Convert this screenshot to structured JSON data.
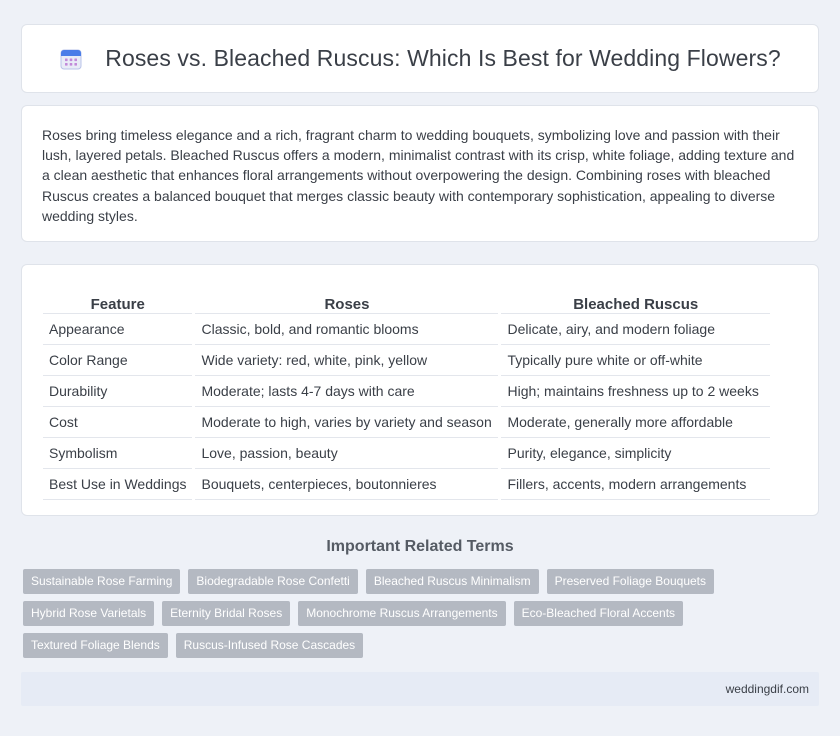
{
  "header": {
    "title": "Roses vs. Bleached Ruscus: Which Is Best for Wedding Flowers?",
    "icon": "calendar-icon"
  },
  "intro": {
    "text": "Roses bring timeless elegance and a rich, fragrant charm to wedding bouquets, symbolizing love and passion with their lush, layered petals. Bleached Ruscus offers a modern, minimalist contrast with its crisp, white foliage, adding texture and a clean aesthetic that enhances floral arrangements without overpowering the design. Combining roses with bleached Ruscus creates a balanced bouquet that merges classic beauty with contemporary sophistication, appealing to diverse wedding styles."
  },
  "table": {
    "headers": [
      "Feature",
      "Roses",
      "Bleached Ruscus"
    ],
    "rows": [
      [
        "Appearance",
        "Classic, bold, and romantic blooms",
        "Delicate, airy, and modern foliage"
      ],
      [
        "Color Range",
        "Wide variety: red, white, pink, yellow",
        "Typically pure white or off-white"
      ],
      [
        "Durability",
        "Moderate; lasts 4-7 days with care",
        "High; maintains freshness up to 2 weeks"
      ],
      [
        "Cost",
        "Moderate to high, varies by variety and season",
        "Moderate, generally more affordable"
      ],
      [
        "Symbolism",
        "Love, passion, beauty",
        "Purity, elegance, simplicity"
      ],
      [
        "Best Use in Weddings",
        "Bouquets, centerpieces, boutonnieres",
        "Fillers, accents, modern arrangements"
      ]
    ]
  },
  "related": {
    "title": "Important Related Terms",
    "tags": [
      "Sustainable Rose Farming",
      "Biodegradable Rose Confetti",
      "Bleached Ruscus Minimalism",
      "Preserved Foliage Bouquets",
      "Hybrid Rose Varietals",
      "Eternity Bridal Roses",
      "Monochrome Ruscus Arrangements",
      "Eco-Bleached Floral Accents",
      "Textured Foliage Blends",
      "Ruscus-Infused Rose Cascades"
    ]
  },
  "footer": {
    "site": "weddingdif.com"
  },
  "colors": {
    "background": "#eef1f7",
    "tag_bg": "#b4b9c2",
    "icon_accent": "#4a7de8",
    "icon_dots": "#c28ad9"
  }
}
